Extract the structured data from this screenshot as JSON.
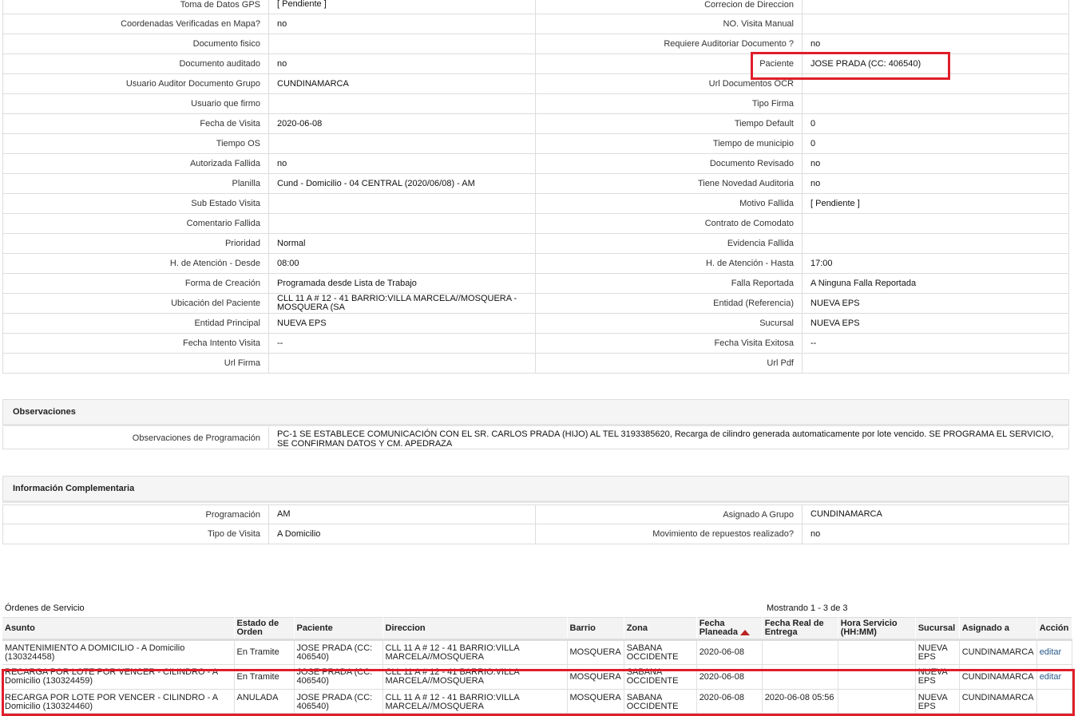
{
  "details": [
    [
      "Toma de Datos GPS",
      "[ Pendiente ]",
      "Correcion de Direccion",
      ""
    ],
    [
      "Coordenadas Verificadas en Mapa?",
      "no",
      "NO. Visita Manual",
      ""
    ],
    [
      "Documento fisico",
      "",
      "Requiere Auditoriar Documento ?",
      "no"
    ],
    [
      "Documento auditado",
      "no",
      "Paciente",
      "JOSE PRADA (CC: 406540)"
    ],
    [
      "Usuario Auditor Documento Grupo",
      "CUNDINAMARCA",
      "Url Documentos OCR",
      ""
    ],
    [
      "Usuario que firmo",
      "",
      "Tipo Firma",
      ""
    ],
    [
      "Fecha de Visita",
      "2020-06-08",
      "Tiempo Default",
      "0"
    ],
    [
      "Tiempo OS",
      "",
      "Tiempo de municipio",
      "0"
    ],
    [
      "Autorizada Fallida",
      "no",
      "Documento Revisado",
      "no"
    ],
    [
      "Planilla",
      "Cund - Domicilio - 04 CENTRAL (2020/06/08) - AM",
      "Tiene Novedad Auditoria",
      "no"
    ],
    [
      "Sub Estado Visita",
      "",
      "Motivo Fallida",
      "[ Pendiente ]"
    ],
    [
      "Comentario Fallida",
      "",
      "Contrato de Comodato",
      ""
    ],
    [
      "Prioridad",
      "Normal",
      "Evidencia Fallida",
      ""
    ],
    [
      "H. de Atención - Desde",
      "08:00",
      "H. de Atención - Hasta",
      "17:00"
    ],
    [
      "Forma de Creación",
      "Programada desde Lista de Trabajo",
      "Falla Reportada",
      "A Ninguna Falla Reportada"
    ],
    [
      "Ubicación del Paciente",
      "CLL 11 A # 12 - 41 BARRIO:VILLA MARCELA//MOSQUERA - MOSQUERA (SA",
      "Entidad (Referencia)",
      "NUEVA EPS"
    ],
    [
      "Entidad Principal",
      "NUEVA EPS",
      "Sucursal",
      "NUEVA EPS"
    ],
    [
      "Fecha Intento Visita",
      "--",
      "Fecha Visita Exitosa",
      "--"
    ],
    [
      "Url Firma",
      "",
      "Url Pdf",
      ""
    ]
  ],
  "observaciones": {
    "title": "Observaciones",
    "label": "Observaciones de Programación",
    "value": "PC-1 SE ESTABLECE COMUNICACIÓN CON EL SR. CARLOS PRADA (HIJO) AL TEL 3193385620, Recarga de cilindro generada automaticamente por lote vencido. SE PROGRAMA EL SERVICIO, SE CONFIRMAN DATOS Y CM. APEDRAZA"
  },
  "complementaria": {
    "title": "Información Complementaria",
    "rows": [
      [
        "Programación",
        "AM",
        "Asignado A Grupo",
        "CUNDINAMARCA"
      ],
      [
        "Tipo de Visita",
        "A Domicilio",
        "Movimiento de repuestos realizado?",
        "no"
      ]
    ]
  },
  "ordenes": {
    "title": "Órdenes de Servicio",
    "count": "Mostrando 1 - 3 de 3",
    "headers": [
      "Asunto",
      "Estado de Orden",
      "Paciente",
      "Direccion",
      "Barrio",
      "Zona",
      "Fecha Planeada",
      "Fecha Real de Entrega",
      "Hora Servicio (HH:MM)",
      "Sucursal",
      "Asignado a",
      "Acción"
    ],
    "rows": [
      [
        "MANTENIMIENTO A DOMICILIO - A Domicilio (130324458)",
        "En Tramite",
        "JOSE PRADA (CC: 406540)",
        "CLL 11 A # 12 - 41 BARRIO:VILLA MARCELA//MOSQUERA",
        "MOSQUERA",
        "SABANA OCCIDENTE",
        "2020-06-08",
        "",
        "",
        "NUEVA EPS",
        "CUNDINAMARCA",
        "editar"
      ],
      [
        "RECARGA POR LOTE POR VENCER - CILINDRO - A Domicilio (130324459)",
        "En Tramite",
        "JOSE PRADA (CC: 406540)",
        "CLL 11 A # 12 - 41 BARRIO:VILLA MARCELA//MOSQUERA",
        "MOSQUERA",
        "SABANA OCCIDENTE",
        "2020-06-08",
        "",
        "",
        "NUEVA EPS",
        "CUNDINAMARCA",
        "editar"
      ],
      [
        "RECARGA POR LOTE POR VENCER - CILINDRO - A Domicilio (130324460)",
        "ANULADA",
        "JOSE PRADA (CC: 406540)",
        "CLL 11 A # 12 - 41 BARRIO:VILLA MARCELA//MOSQUERA",
        "MOSQUERA",
        "SABANA OCCIDENTE",
        "2020-06-08",
        "2020-06-08 05:56",
        "",
        "NUEVA EPS",
        "CUNDINAMARCA",
        ""
      ]
    ]
  },
  "colors": {
    "highlight": "#e01e2a",
    "sort_arrow": "#b22222"
  }
}
